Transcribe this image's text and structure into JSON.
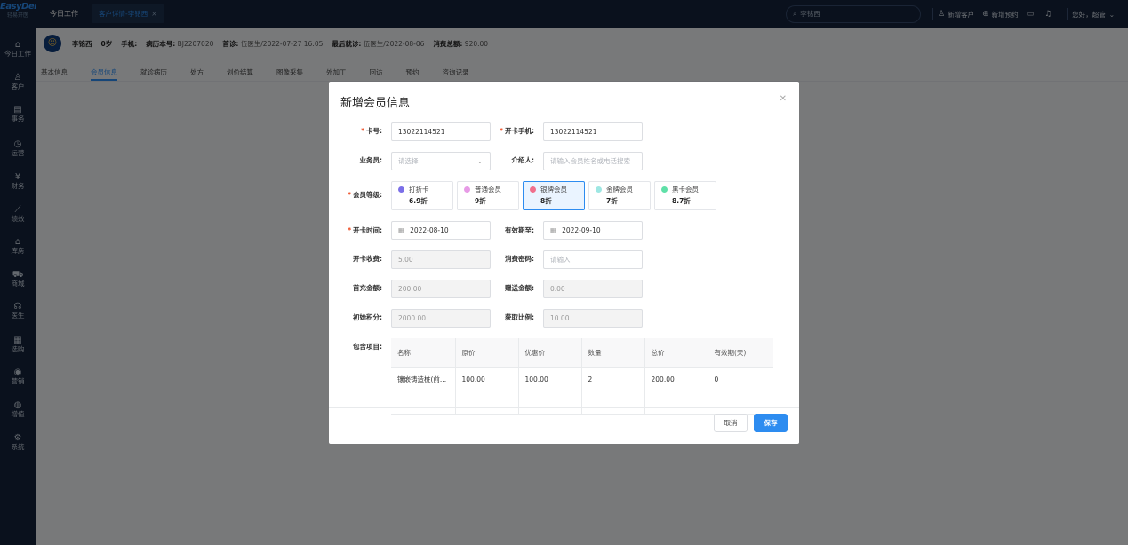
{
  "app": {
    "logo": "EasyDent",
    "logo_sub": "轻易开医"
  },
  "sidebar": {
    "items": [
      {
        "icon": "home-icon",
        "glyph": "⌂",
        "label": "今日工作"
      },
      {
        "icon": "user-icon",
        "glyph": "♙",
        "label": "客户"
      },
      {
        "icon": "task-icon",
        "glyph": "▤",
        "label": "事务"
      },
      {
        "icon": "clock-icon",
        "glyph": "◷",
        "label": "运营"
      },
      {
        "icon": "finance-icon",
        "glyph": "¥",
        "label": "财务"
      },
      {
        "icon": "chart-icon",
        "glyph": "⟋",
        "label": "绩效"
      },
      {
        "icon": "warehouse-icon",
        "glyph": "⌂",
        "label": "库房"
      },
      {
        "icon": "cart-icon",
        "glyph": "⛟",
        "label": "商城"
      },
      {
        "icon": "doctor-icon",
        "glyph": "☊",
        "label": "医生"
      },
      {
        "icon": "report-icon",
        "glyph": "▦",
        "label": "选购"
      },
      {
        "icon": "marketing-icon",
        "glyph": "◉",
        "label": "营销"
      },
      {
        "icon": "value-icon",
        "glyph": "◍",
        "label": "增值"
      },
      {
        "icon": "settings-icon",
        "glyph": "⚙",
        "label": "系统"
      }
    ]
  },
  "topbar": {
    "home_tab": "今日工作",
    "active_tab": "客户详情-李铭西",
    "search_value": "李铭西",
    "actions": {
      "new_customer": "新增客户",
      "new_appointment": "新增预约",
      "greeting": "您好，超管"
    }
  },
  "patient": {
    "name": "李铭西",
    "age": "0岁",
    "phone_label": "手机:",
    "record_label": "病历本号:",
    "record_no": "BJ2207020",
    "first_visit_label": "首诊:",
    "first_visit": "伍医生/2022-07-27 16:05",
    "last_visit_label": "最后就诊:",
    "last_visit": "伍医生/2022-08-06",
    "total_label": "消费总额:",
    "total": "920.00"
  },
  "subtabs": [
    "基本信息",
    "会员信息",
    "就诊病历",
    "处方",
    "划价结算",
    "图像采集",
    "外加工",
    "回访",
    "预约",
    "咨询记录"
  ],
  "modal": {
    "title": "新增会员信息",
    "card_no_label": "卡号:",
    "card_no": "13022114521",
    "phone_label": "开卡手机:",
    "phone": "13022114521",
    "salesperson_label": "业务员:",
    "salesperson_placeholder": "请选择",
    "referrer_label": "介绍人:",
    "referrer_placeholder": "请输入会员姓名或电话搜索",
    "grade_label": "会员等级:",
    "grades": [
      {
        "name": "打折卡",
        "discount": "6.9折",
        "color": "#7b6fe8"
      },
      {
        "name": "普通会员",
        "discount": "9折",
        "color": "#e79be6"
      },
      {
        "name": "银牌会员",
        "discount": "8折",
        "color": "#f06f8c"
      },
      {
        "name": "金牌会员",
        "discount": "7折",
        "color": "#9ee7e3"
      },
      {
        "name": "黑卡会员",
        "discount": "8.7折",
        "color": "#5fe0a8"
      }
    ],
    "open_time_label": "开卡时间:",
    "open_time": "2022-08-10",
    "valid_until_label": "有效期至:",
    "valid_until": "2022-09-10",
    "fee_label": "开卡收费:",
    "fee": "5.00",
    "password_label": "消费密码:",
    "password_placeholder": "请输入",
    "first_recharge_label": "首充金额:",
    "first_recharge": "200.00",
    "gift_label": "赠送金额:",
    "gift": "0.00",
    "points_label": "初始积分:",
    "points": "2000.00",
    "ratio_label": "获取比例:",
    "ratio": "10.00",
    "package_label": "包含项目:",
    "table": {
      "headers": [
        "名称",
        "原价",
        "优惠价",
        "数量",
        "总价",
        "有效期(天)"
      ],
      "rows": [
        [
          "镶嵌铸造桩(前...",
          "100.00",
          "100.00",
          "2",
          "200.00",
          "0"
        ]
      ]
    },
    "cancel": "取消",
    "save": "保存"
  }
}
